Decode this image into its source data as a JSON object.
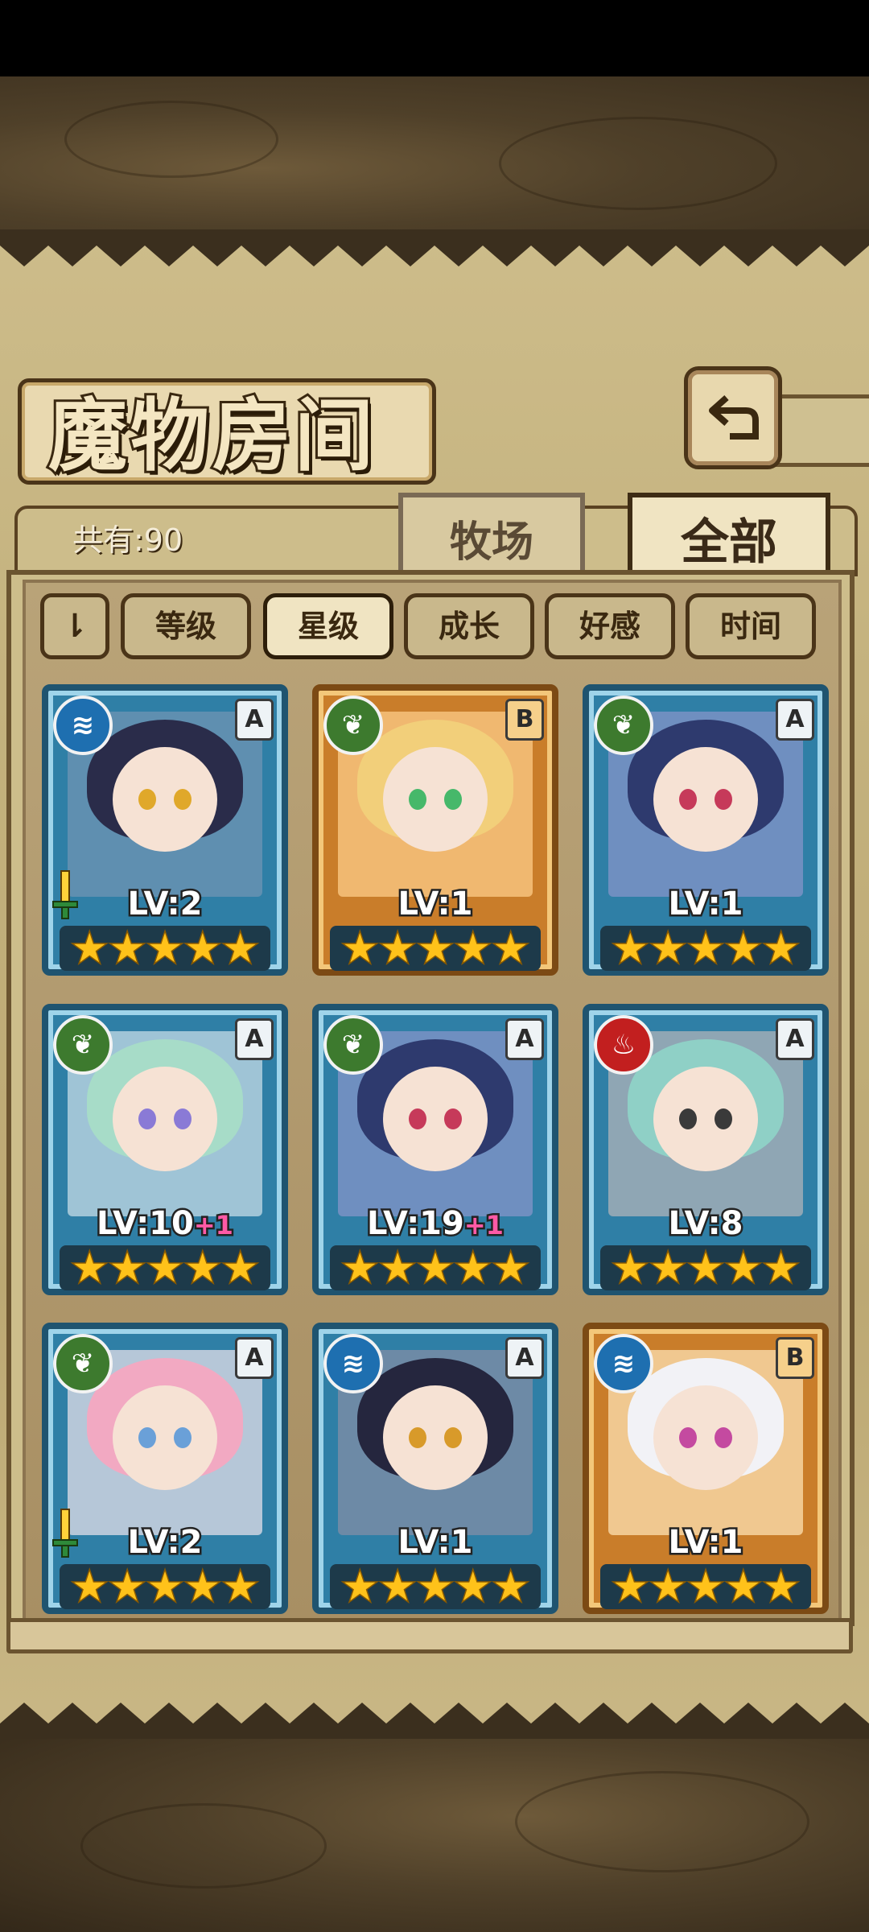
{
  "header": {
    "title": "魔物房间",
    "count_label": "共有:90"
  },
  "tabs": {
    "farm": "牧场",
    "all": "全部"
  },
  "sort": {
    "toggle_icon": "⇂",
    "buttons": [
      "等级",
      "星级",
      "成长",
      "好感",
      "时间"
    ],
    "active": "星级"
  },
  "cards": [
    {
      "element": "water",
      "rank": "A",
      "level": "LV:2",
      "plus": "",
      "stars": 5,
      "weapon": true
    },
    {
      "element": "leaf",
      "rank": "B",
      "level": "LV:1",
      "plus": "",
      "stars": 5,
      "weapon": false
    },
    {
      "element": "leaf",
      "rank": "A",
      "level": "LV:1",
      "plus": "",
      "stars": 5,
      "weapon": false
    },
    {
      "element": "leaf",
      "rank": "A",
      "level": "LV:10",
      "plus": "+1",
      "stars": 5,
      "weapon": false
    },
    {
      "element": "leaf",
      "rank": "A",
      "level": "LV:19",
      "plus": "+1",
      "stars": 5,
      "weapon": false
    },
    {
      "element": "fire",
      "rank": "A",
      "level": "LV:8",
      "plus": "",
      "stars": 5,
      "weapon": false
    },
    {
      "element": "leaf",
      "rank": "A",
      "level": "LV:2",
      "plus": "",
      "stars": 5,
      "weapon": true
    },
    {
      "element": "water",
      "rank": "A",
      "level": "LV:1",
      "plus": "",
      "stars": 5,
      "weapon": false
    },
    {
      "element": "water",
      "rank": "B",
      "level": "LV:1",
      "plus": "",
      "stars": 5,
      "weapon": false
    }
  ],
  "colors": {
    "parchment": "#c4b27e",
    "frame": "#6b5430",
    "rank_A": "#2f7fa6",
    "rank_B": "#c97d2a"
  }
}
